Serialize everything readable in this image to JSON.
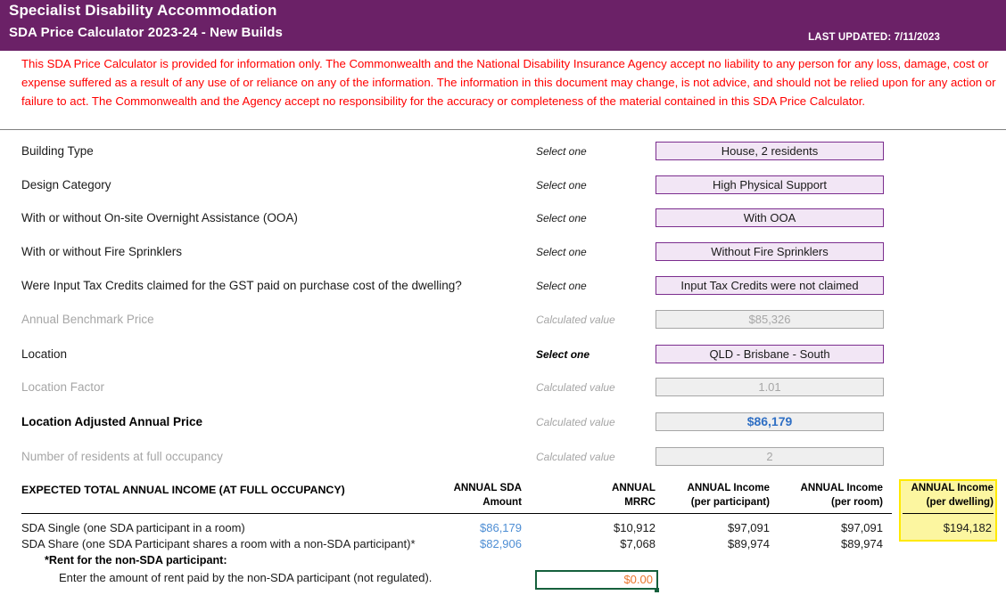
{
  "header": {
    "title": "Specialist Disability Accommodation",
    "subtitle": "SDA Price Calculator 2023-24 - New Builds",
    "last_updated_label": "LAST UPDATED:",
    "last_updated_value": "7/11/2023",
    "bg_color": "#6B2167",
    "text_color": "#FFFFFF"
  },
  "disclaimer": {
    "text": "This SDA Price Calculator is provided for information only.  The Commonwealth and the National Disability Insurance Agency accept no liability to any person for any loss, damage, cost or expense suffered as a result of any use of or reliance on any of the information.  The information in this document may change, is not advice, and should not be relied upon for any action or failure to act. The Commonwealth and the Agency accept no responsibility for the accuracy or completeness of the material contained in this SDA Price Calculator.",
    "color": "#FF0000"
  },
  "form": {
    "hint_select": "Select one",
    "hint_calculated": "Calculated value",
    "rows": [
      {
        "label": "Building Type",
        "hint": "Select one",
        "kind": "select",
        "value": "House, 2 residents"
      },
      {
        "label": "Design Category",
        "hint": "Select one",
        "kind": "select",
        "value": "High Physical Support"
      },
      {
        "label": "With or without On-site Overnight Assistance (OOA)",
        "hint": "Select one",
        "kind": "select",
        "value": "With OOA"
      },
      {
        "label": "With or without Fire Sprinklers",
        "hint": "Select one",
        "kind": "select",
        "value": "Without Fire Sprinklers"
      },
      {
        "label": "Were Input Tax Credits claimed for the GST paid on purchase cost of the dwelling?",
        "hint": "Select one",
        "kind": "select",
        "value": "Input Tax Credits were not claimed"
      },
      {
        "label": "Annual Benchmark Price",
        "hint": "Calculated value",
        "kind": "calc",
        "value": "$85,326"
      },
      {
        "label": "Location",
        "hint": "Select one",
        "kind": "select",
        "value": "QLD - Brisbane - South"
      },
      {
        "label": "Location Factor",
        "hint": "Calculated value",
        "kind": "calc",
        "value": "1.01"
      },
      {
        "label": "Location Adjusted Annual Price",
        "hint": "Calculated value",
        "kind": "calc",
        "value": "$86,179"
      },
      {
        "label": "Number of residents at full occupancy",
        "hint": "Calculated value",
        "kind": "calc",
        "value": "2"
      }
    ]
  },
  "income_table": {
    "title": "EXPECTED TOTAL ANNUAL INCOME (AT FULL OCCUPANCY)",
    "columns": [
      {
        "line1": "ANNUAL SDA",
        "line2": "Amount"
      },
      {
        "line1": "ANNUAL",
        "line2": "MRRC"
      },
      {
        "line1": "ANNUAL Income",
        "line2": "(per participant)"
      },
      {
        "line1": "ANNUAL Income",
        "line2": "(per room)"
      },
      {
        "line1": "ANNUAL Income",
        "line2": "(per dwelling)"
      }
    ],
    "rows": [
      {
        "label": "SDA Single (one SDA participant in a room)",
        "sda_amount": "$86,179",
        "mrrc": "$10,912",
        "per_participant": "$97,091",
        "per_room": "$97,091",
        "per_dwelling": "$194,182"
      },
      {
        "label": "SDA Share (one SDA Participant shares a room with a non-SDA participant)*",
        "sda_amount": "$82,906",
        "mrrc": "$7,068",
        "per_participant": "$89,974",
        "per_room": "$89,974",
        "per_dwelling": ""
      }
    ],
    "rent_heading": "*Rent for the non-SDA participant:",
    "rent_instruction": "Enter the amount of rent paid by the non-SDA participant (not regulated).",
    "rent_input_value": "$0.00",
    "highlight_color": "#FFE900",
    "highlight_fill": "#FCF6A0",
    "input_border_color": "#15603C",
    "input_text_color": "#E8762C"
  }
}
